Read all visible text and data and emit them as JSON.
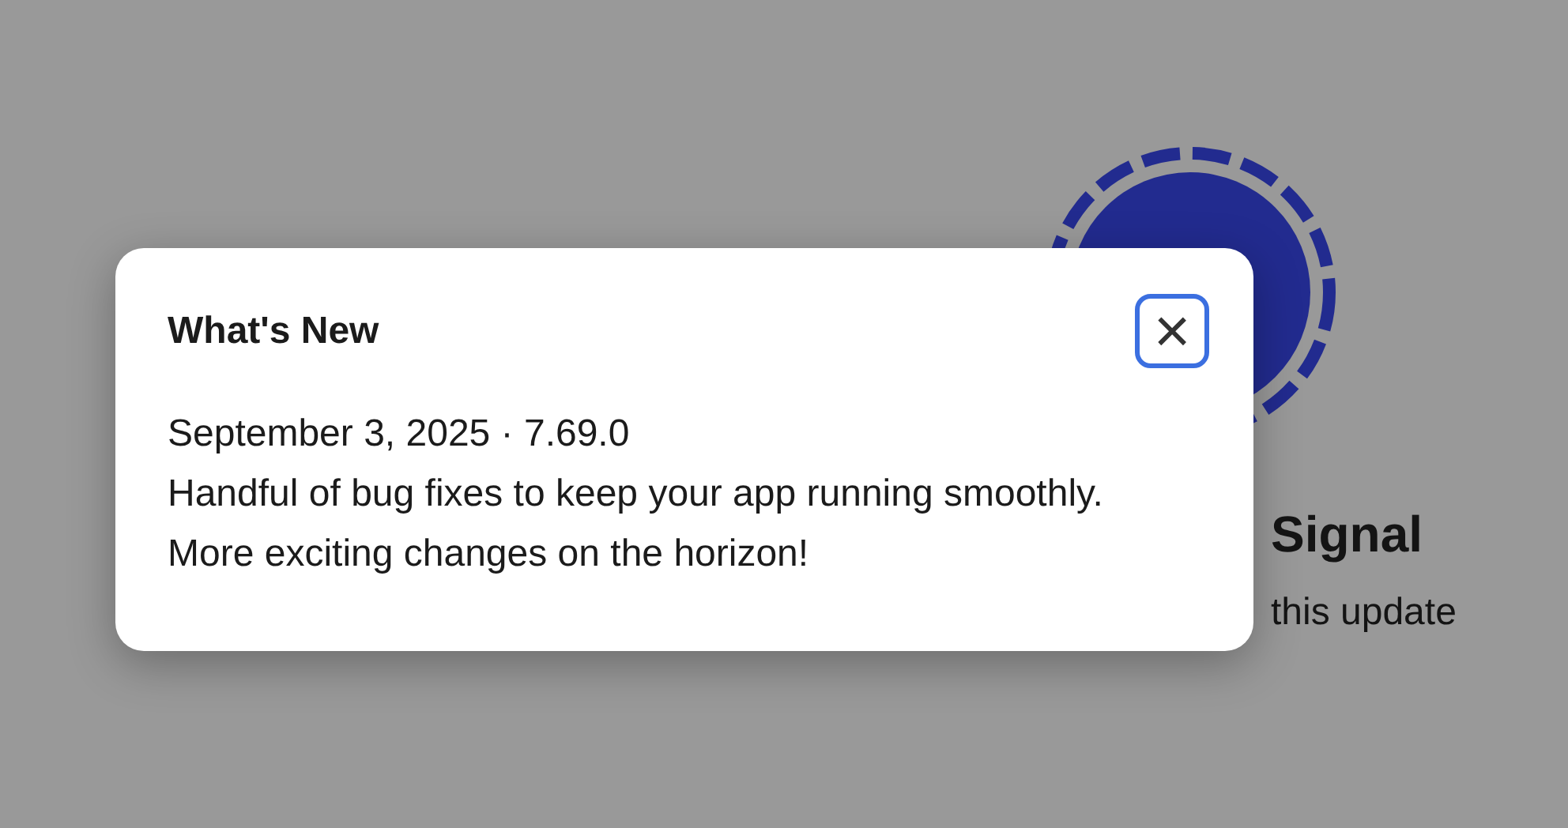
{
  "background": {
    "title": "Signal",
    "subtitle": "this update"
  },
  "dialog": {
    "title": "What's New",
    "close_label": "×",
    "release": "September 3, 2025 · 7.69.0",
    "body": "Handful of bug fixes to keep your app running smoothly. More exciting changes on the horizon!"
  }
}
